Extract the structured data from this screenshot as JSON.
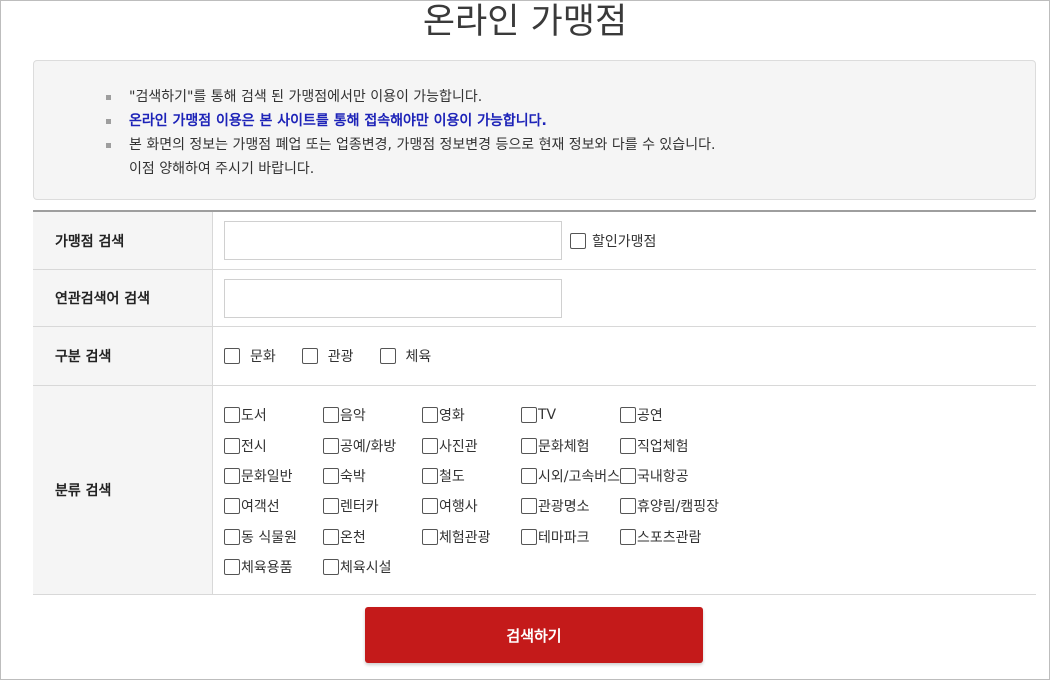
{
  "page": {
    "title": "온라인 가맹점"
  },
  "notice": {
    "items": [
      {
        "text": "\"검색하기\"를 통해 검색 된 가맹점에서만 이용이 가능합니다.",
        "highlight": false
      },
      {
        "text": "온라인 가맹점 이용은 본 사이트를 통해 접속해야만 이용이 가능합니다.",
        "highlight": true
      },
      {
        "text": "본 화면의 정보는 가맹점 폐업 또는 업종변경, 가맹점 정보변경 등으로 현재 정보와 다를 수 있습니다.",
        "continuation": "이점 양해하여 주시기 바랍니다.",
        "highlight": false
      }
    ],
    "highlight_color": "#1d23b8"
  },
  "form": {
    "store_search": {
      "label": "가맹점 검색",
      "value": "",
      "placeholder": "",
      "discount_label": "할인가맹점",
      "discount_checked": false
    },
    "related_search": {
      "label": "연관검색어 검색",
      "value": "",
      "placeholder": ""
    },
    "type_search": {
      "label": "구분 검색",
      "options": [
        "문화",
        "관광",
        "체육"
      ]
    },
    "category_search": {
      "label": "분류 검색",
      "options": [
        "도서",
        "음악",
        "영화",
        "TV",
        "공연",
        "전시",
        "공예/화방",
        "사진관",
        "문화체험",
        "직업체험",
        "문화일반",
        "숙박",
        "철도",
        "시외/고속버스",
        "국내항공",
        "여객선",
        "렌터카",
        "여행사",
        "관광명소",
        "휴양림/캠핑장",
        "동 식물원",
        "온천",
        "체험관광",
        "테마파크",
        "스포츠관람",
        "체육용품",
        "체육시설"
      ]
    }
  },
  "actions": {
    "search_label": "검색하기",
    "search_color": "#c41a1a"
  }
}
